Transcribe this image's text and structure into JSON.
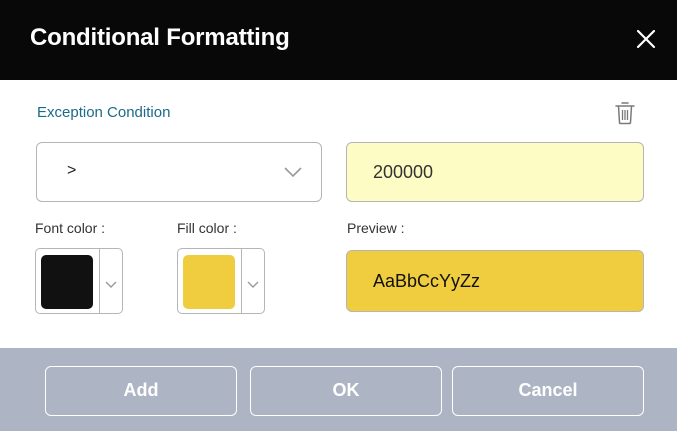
{
  "dialog": {
    "title": "Conditional Formatting",
    "close_icon": "close-icon"
  },
  "condition": {
    "section_label": "Exception Condition",
    "delete_icon": "trash-icon",
    "operator": ">",
    "dropdown_icon": "chevron-down-icon",
    "value": "200000"
  },
  "font_color": {
    "label": "Font color :",
    "color": "#111111"
  },
  "fill_color": {
    "label": "Fill color :",
    "color": "#f0cd3f"
  },
  "preview": {
    "label": "Preview :",
    "text": "AaBbCcYyZz",
    "text_color": "#111111",
    "background": "#f0cd3f"
  },
  "footer": {
    "add_label": "Add",
    "ok_label": "OK",
    "cancel_label": "Cancel"
  },
  "colors": {
    "titlebar": "#080808",
    "section_label": "#1b6a88",
    "value_input_bg": "#fcfcc4",
    "footer_bg": "#adb5c5"
  }
}
